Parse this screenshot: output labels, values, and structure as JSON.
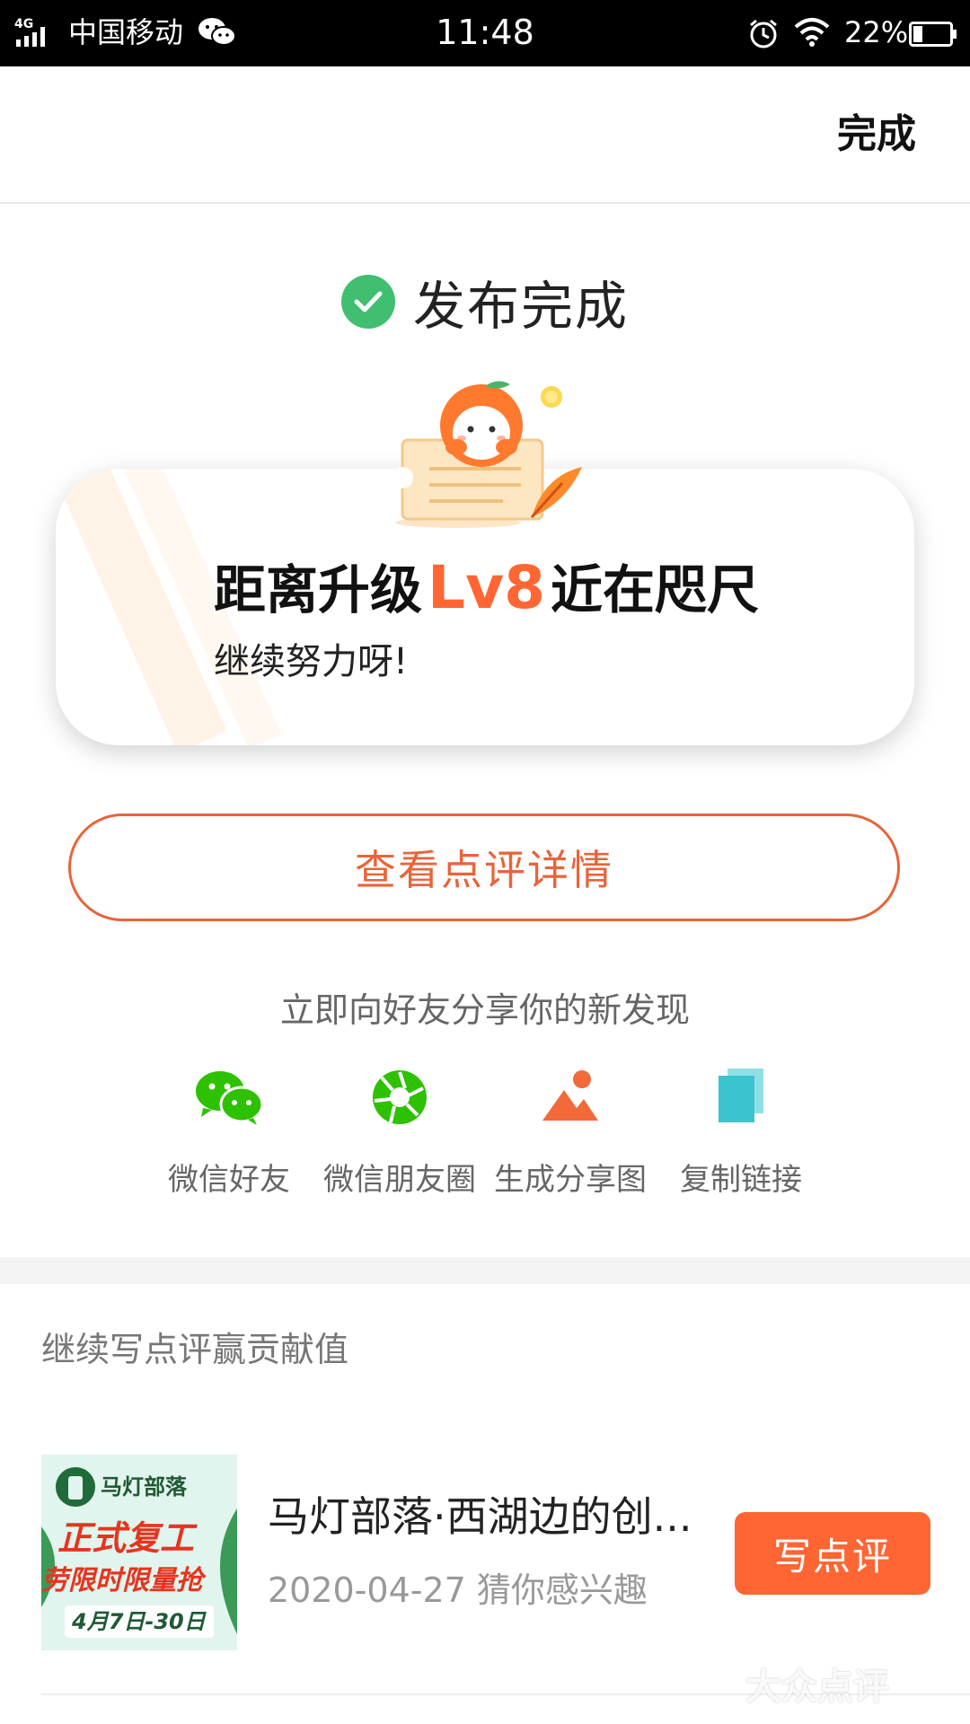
{
  "status_bar": {
    "network": "4G",
    "carrier": "中国移动",
    "time": "11:48",
    "battery": "22%"
  },
  "nav": {
    "done_label": "完成"
  },
  "publish": {
    "title": "发布完成"
  },
  "level_card": {
    "prefix": "距离升级",
    "level": "Lv8",
    "suffix": "近在咫尺",
    "subtitle": "继续努力呀!"
  },
  "view_review_label": "查看点评详情",
  "share": {
    "prompt": "立即向好友分享你的新发现",
    "items": [
      {
        "label": "微信好友",
        "icon": "wechat-icon"
      },
      {
        "label": "微信朋友圈",
        "icon": "moments-icon"
      },
      {
        "label": "生成分享图",
        "icon": "image-icon"
      },
      {
        "label": "复制链接",
        "icon": "copy-link-icon"
      }
    ]
  },
  "continue_section": {
    "title": "继续写点评赢贡献值"
  },
  "poi": {
    "name": "马灯部落·西湖边的创...",
    "meta": "2020-04-27 猜你感兴趣",
    "action_label": "写点评",
    "thumb": {
      "brand": "马灯部落",
      "headline": "正式复工",
      "promo": "劳限时限量抢",
      "dates": "4月7日-30日"
    }
  },
  "watermark": "大众点评",
  "colors": {
    "accent": "#ff6633",
    "success": "#3fbf6f",
    "wechat": "#2dc100",
    "copy": "#3bc4cf"
  }
}
